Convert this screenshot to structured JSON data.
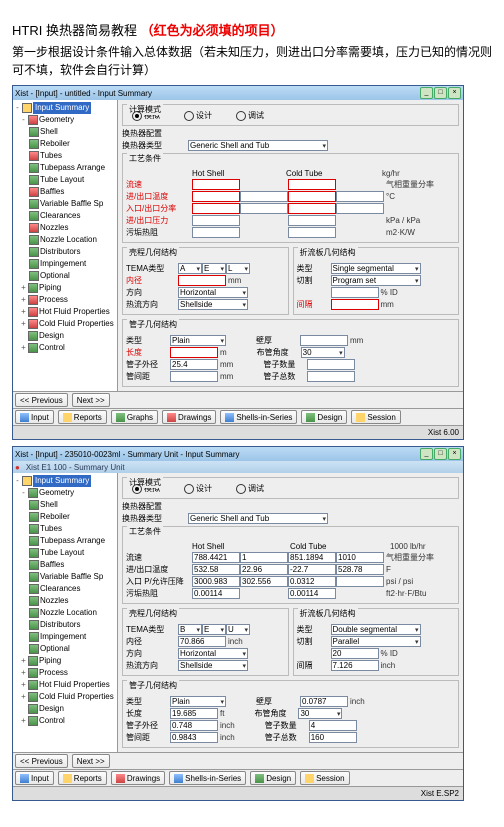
{
  "doc": {
    "title_prefix": "HTRI 换热器简易教程",
    "title_red": "（红色为必须填的项目）",
    "subtitle": "第一步根据设计条件输入总体数据（若未知压力，则进出口分率需要填，压力已知的情况则可不填，软件会自行计算）"
  },
  "common": {
    "tree": [
      "Input Summary",
      "Geometry",
      "Shell",
      "Reboiler",
      "Tubes",
      "Tubepass Arrange",
      "Tube Layout",
      "Baffles",
      "Variable Baffle Sp",
      "Clearances",
      "Nozzles",
      "Nozzle Location",
      "Distributors",
      "Impingement",
      "Optional",
      "Piping",
      "Process",
      "Hot Fluid Properties",
      "Cold Fluid Properties",
      "Design",
      "Control"
    ],
    "toolbar": [
      "<< Previous",
      "Next >>"
    ],
    "tabs": [
      "Input",
      "Reports",
      "Graphs",
      "Drawings",
      "Shells-in-Series",
      "Design",
      "Session"
    ],
    "status_left": "",
    "status_right": "Xist 6.00",
    "modes": [
      "模拟",
      "设计",
      "调试"
    ],
    "labels": {
      "calc_mode": "计算模式",
      "hx_config": "换热器配置",
      "hx_type": "换热器类型",
      "hot_shell": "Hot Shell",
      "cold_tube": "Cold Tube",
      "process": "工艺条件",
      "flow": "流速",
      "in_out_temp": "进/出口温度",
      "in_out_p": "进/出口压力",
      "in_out_frac": "入口/出口分率",
      "fouling": "污垢热阻",
      "shell_geom": "壳程几何结构",
      "baffle_geom": "折流板几何结构",
      "tema": "TEMA类型",
      "type": "类型",
      "id": "内径",
      "orient": "方向",
      "ht_orient": "热流方向",
      "cut": "切割",
      "interval": "间隔",
      "tube_geom": "管子几何结构",
      "tube_type": "类型",
      "length": "长度",
      "pitch": "壁厚",
      "layout": "布管角度",
      "od": "管子外径",
      "pitch2": "管间距",
      "count": "管子数量",
      "pass": "管子总数"
    },
    "units": {
      "kghr": "kg/hr",
      "c": "°C",
      "kpa": "kPa",
      "m2kw": "m2·K/W",
      "mm": "mm",
      "inch": "inch",
      "m": "m",
      "qdx": "气相重量分率",
      "f": "F",
      "psi": "psi",
      "ft2hrf": "ft2·hr·F/Btu",
      "ft": "ft"
    },
    "sel": {
      "generic": "Generic Shell and Tub",
      "horizontal": "Horizontal",
      "shellside": "Shellside",
      "plain": "Plain",
      "parallel": "Parallel",
      "programset": "Program set",
      "single_seg": "Single segmental",
      "double_seg": "Double segmental"
    }
  },
  "win1": {
    "title": "Xist - [Input] - untitled - Input Summary",
    "tema": [
      "A",
      "E",
      "L"
    ],
    "id": "",
    "od": "25.4",
    "pitch": "",
    "tube_len": "",
    "tube_type": "Plain",
    "baffle_int": "",
    "hot": [
      "",
      "",
      "",
      "",
      "",
      "",
      "",
      ""
    ],
    "cold": [
      "",
      "",
      "",
      "",
      "",
      "",
      "",
      ""
    ]
  },
  "win2": {
    "title": "Xist - [Input] - 235010-0023ml - Summary Unit - Input Summary",
    "strip": "Xist E1 100 - Summary Unit",
    "tema": [
      "B",
      "E",
      "U"
    ],
    "id": "70.866",
    "od": "0.748",
    "tube_len": "19.685",
    "tube_pitch": "",
    "tube_count": "",
    "baffle_type": "Double segmental",
    "baffle_cut": "Parallel",
    "baffle_cut_pct": "20",
    "baffle_int": "7.126",
    "hot": [
      "788.4421",
      "532.58",
      "22.96",
      "3000.983",
      ""
    ],
    "cold": [
      "851.1894",
      "-22.7",
      "528.78",
      "0.0312",
      ""
    ],
    "hot2": [
      "",
      "",
      "",
      ""
    ],
    "cold2": [
      "1010",
      "",
      "",
      ""
    ],
    "status_right": "Xist E.SP2",
    "layout": "30",
    "pass": "160"
  }
}
